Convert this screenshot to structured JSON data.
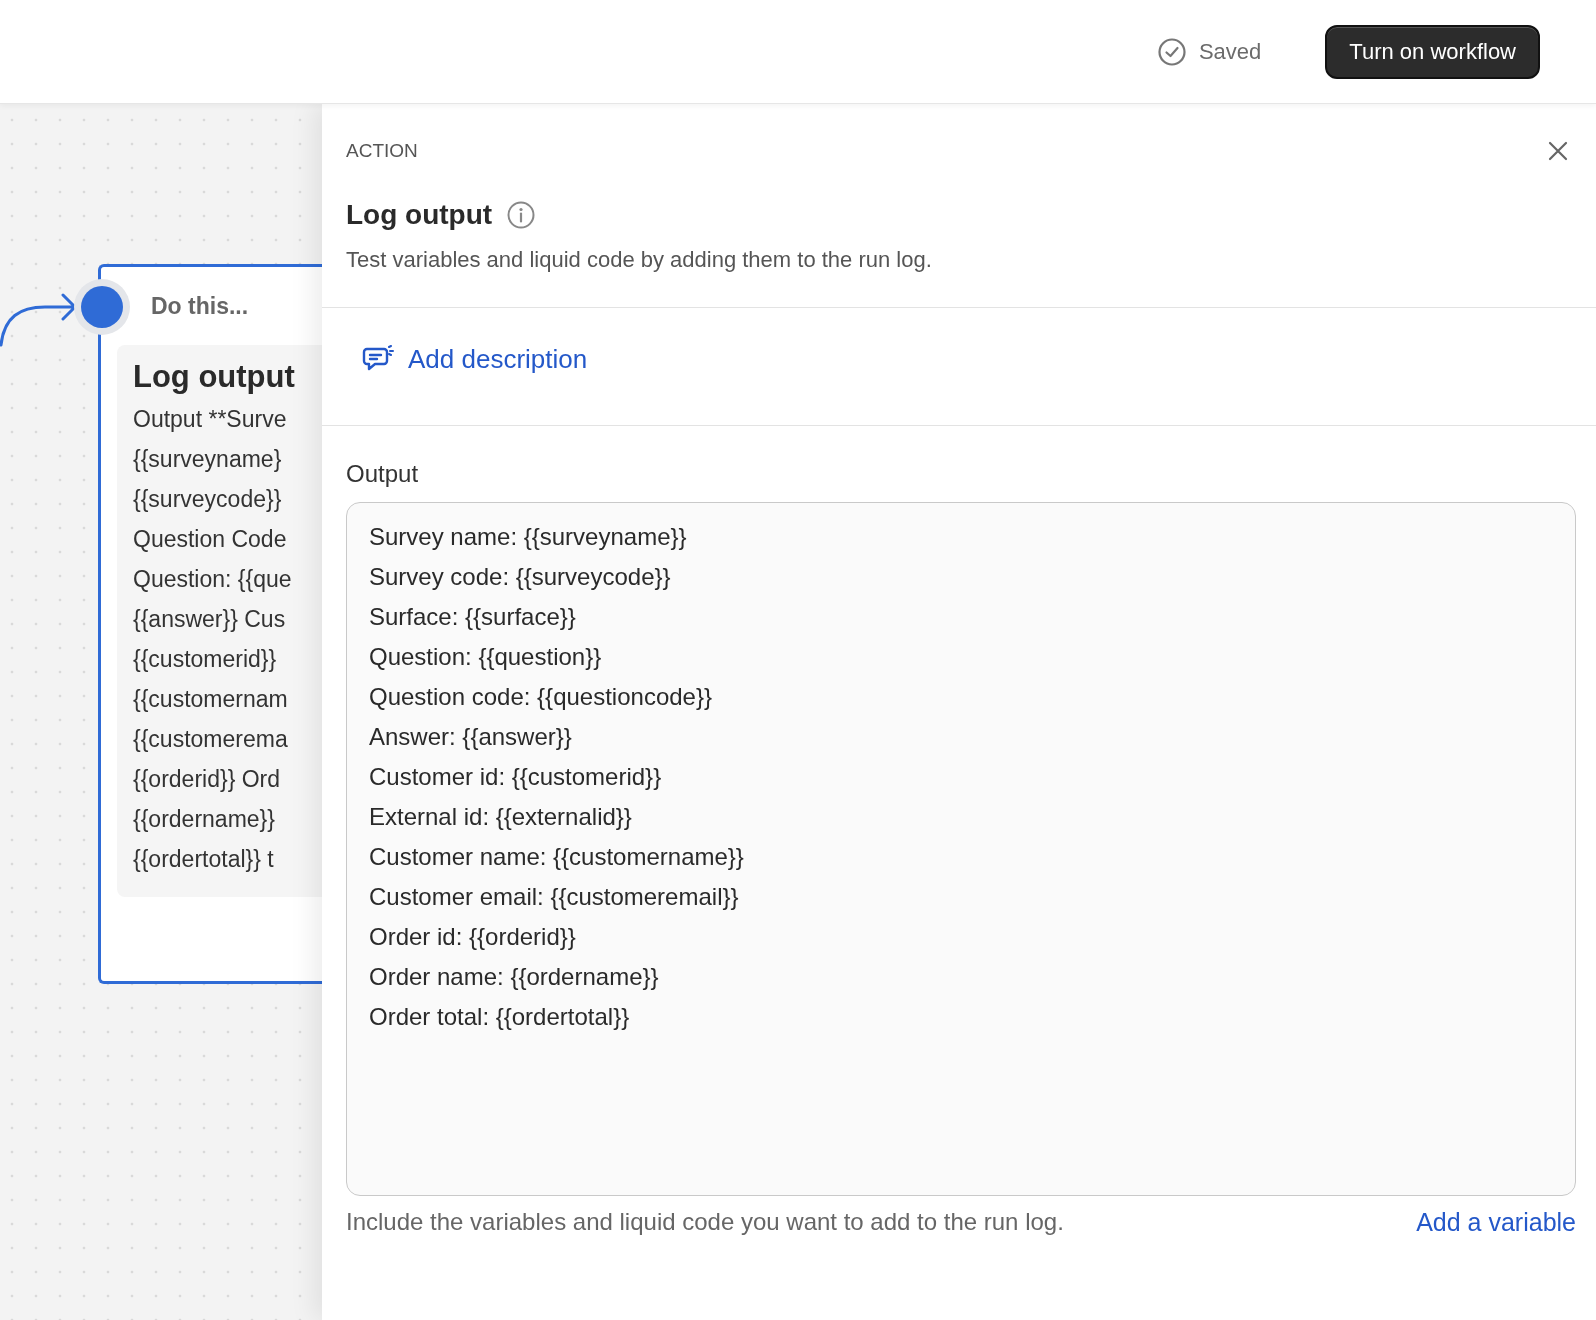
{
  "header": {
    "status": {
      "label": "Saved",
      "saved": true
    },
    "primary_button": "Turn on workflow"
  },
  "canvas": {
    "node": {
      "header": "Do this...",
      "title": "Log output",
      "lines": [
        "Output **Surve",
        "{{surveyname}",
        "{{surveycode}}",
        "Question Code",
        "Question: {{que",
        "{{answer}} Cus",
        "{{customerid}}",
        "{{customernam",
        "{{customerema",
        "{{orderid}} Ord",
        "{{ordername}}",
        "{{ordertotal}} t"
      ],
      "selected": true
    }
  },
  "panel": {
    "eyebrow": "ACTION",
    "title": "Log output",
    "description": "Test variables and liquid code by adding them to the run log.",
    "add_description": "Add description",
    "output": {
      "label": "Output",
      "value": [
        "Survey name: {{surveyname}}",
        "Survey code: {{surveycode}}",
        "Surface: {{surface}}",
        "Question: {{question}}",
        "Question code: {{questioncode}}",
        "Answer: {{answer}}",
        "Customer id: {{customerid}}",
        "External id: {{externalid}}",
        "Customer name: {{customername}}",
        "Customer email: {{customeremail}}",
        "Order id: {{orderid}}",
        "Order name: {{ordername}}",
        "Order total: {{ordertotal}}"
      ],
      "help": "Include the variables and liquid code you want to add to the run log.",
      "add_variable": "Add a variable"
    }
  }
}
